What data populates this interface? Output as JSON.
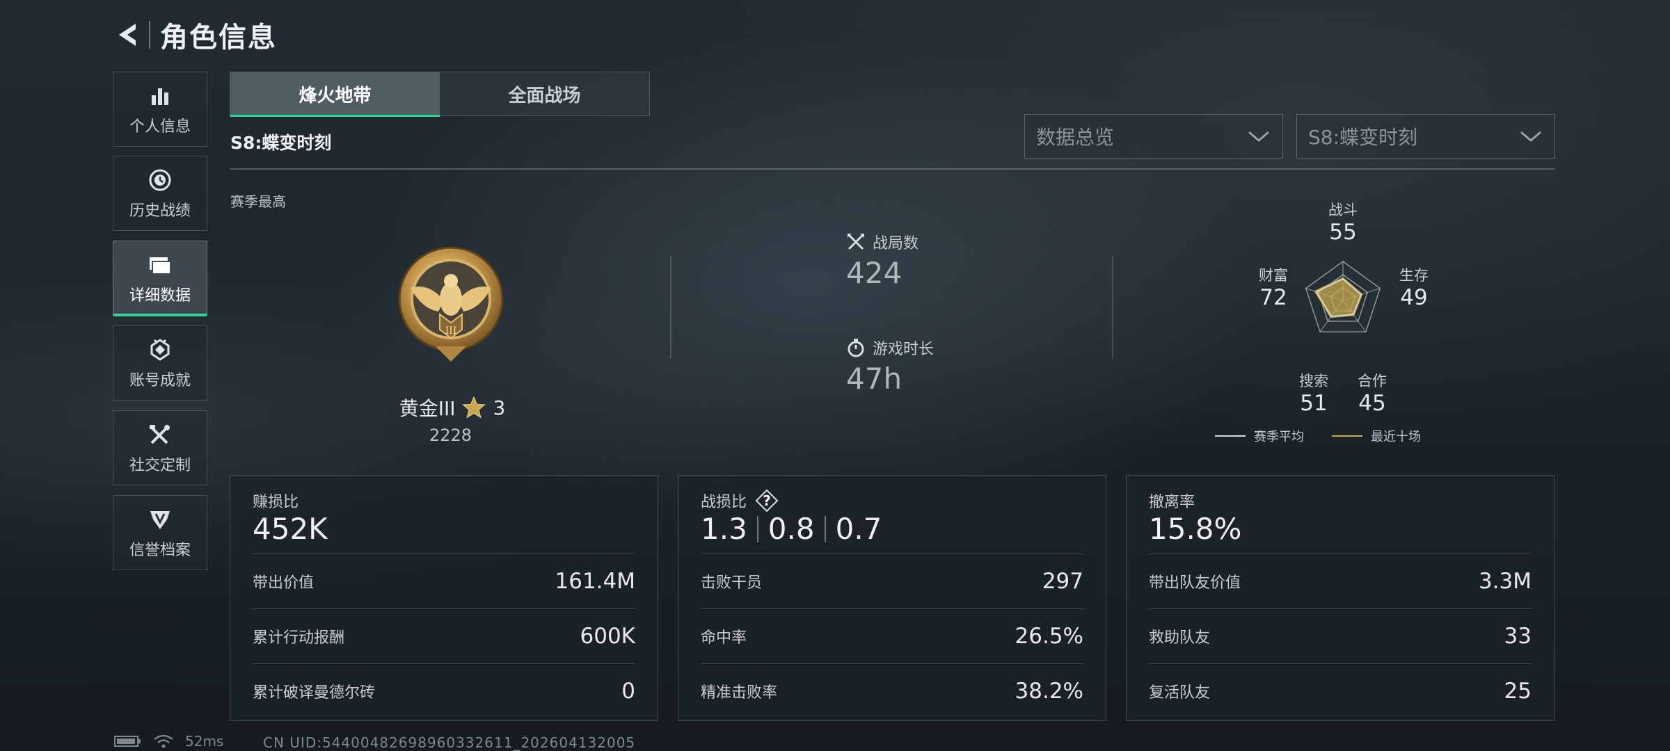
{
  "header": {
    "title": "角色信息"
  },
  "sidebar": {
    "items": [
      {
        "label": "个人信息",
        "icon": "bar-chart-icon"
      },
      {
        "label": "历史战绩",
        "icon": "clock-icon"
      },
      {
        "label": "详细数据",
        "icon": "folder-icon",
        "active": true
      },
      {
        "label": "账号成就",
        "icon": "achievement-icon"
      },
      {
        "label": "社交定制",
        "icon": "tools-icon"
      },
      {
        "label": "信誉档案",
        "icon": "shield-icon"
      }
    ]
  },
  "tabs": [
    {
      "label": "烽火地带",
      "active": true
    },
    {
      "label": "全面战场",
      "active": false
    }
  ],
  "season": {
    "title": "S8:蝶变时刻",
    "best_label": "赛季最高"
  },
  "filters": {
    "data_view": "数据总览",
    "season_select": "S8:蝶变时刻"
  },
  "rank": {
    "name": "黄金III",
    "stars": "3",
    "score": "2228"
  },
  "summary": {
    "matches_label": "战局数",
    "matches_value": "424",
    "playtime_label": "游戏时长",
    "playtime_value": "47h"
  },
  "radar": {
    "axes": [
      {
        "label": "战斗",
        "value": "55"
      },
      {
        "label": "生存",
        "value": "49"
      },
      {
        "label": "合作",
        "value": "45"
      },
      {
        "label": "搜索",
        "value": "51"
      },
      {
        "label": "财富",
        "value": "72"
      }
    ],
    "legend": {
      "season_avg": "赛季平均",
      "recent_ten": "最近十场"
    },
    "colors": {
      "season_avg": "#d8dde1",
      "recent_ten": "#c9a94f"
    }
  },
  "cards": {
    "profit": {
      "title": "赚损比",
      "value": "452K",
      "rows": [
        {
          "label": "带出价值",
          "value": "161.4M"
        },
        {
          "label": "累计行动报酬",
          "value": "600K"
        },
        {
          "label": "累计破译曼德尔砖",
          "value": "0"
        }
      ]
    },
    "kd": {
      "title": "战损比",
      "help": "?",
      "values": [
        "1.3",
        "0.8",
        "0.7"
      ],
      "rows": [
        {
          "label": "击败干员",
          "value": "297"
        },
        {
          "label": "命中率",
          "value": "26.5%"
        },
        {
          "label": "精准击败率",
          "value": "38.2%"
        }
      ]
    },
    "extract": {
      "title": "撤离率",
      "value": "15.8%",
      "rows": [
        {
          "label": "带出队友价值",
          "value": "3.3M"
        },
        {
          "label": "救助队友",
          "value": "33"
        },
        {
          "label": "复活队友",
          "value": "25"
        }
      ]
    }
  },
  "footer": {
    "ping": "52ms",
    "uid": "CN UID:54400482698960332611_202604132005"
  },
  "colors": {
    "accent": "#37d39a",
    "gold": "#c9a94f"
  }
}
